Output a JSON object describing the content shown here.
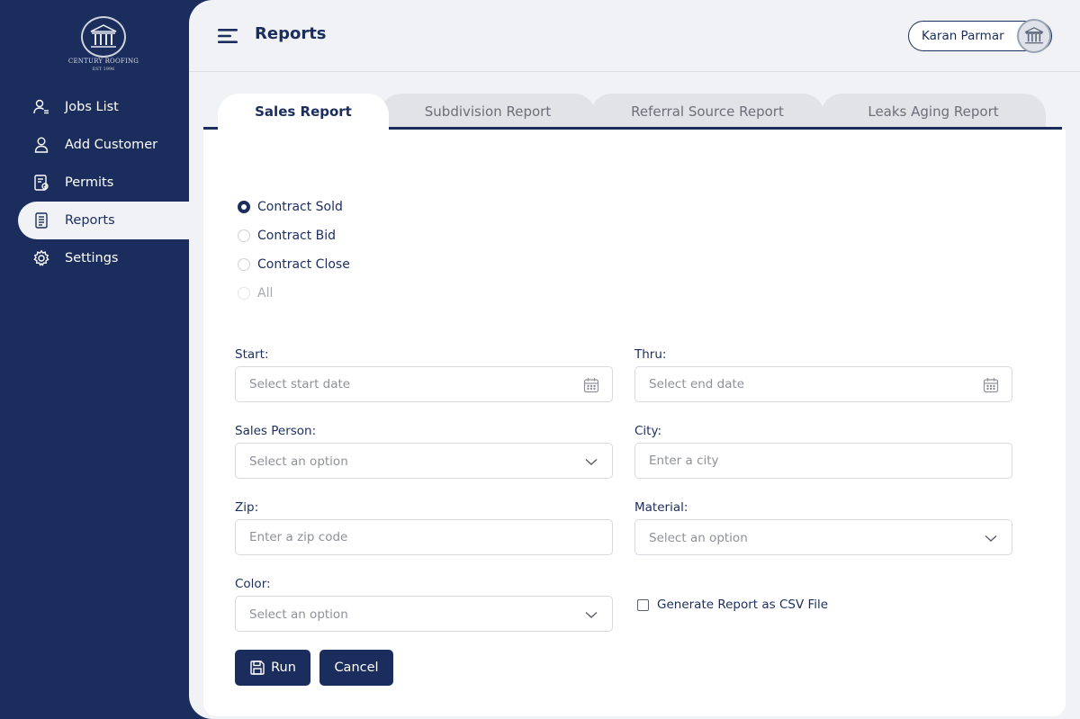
{
  "app": {
    "logo_text": "CENTURY ROOFING",
    "logo_sub": "EST 1996"
  },
  "sidebar": {
    "items": [
      {
        "label": "Jobs List",
        "icon": "user-list-icon"
      },
      {
        "label": "Add Customer",
        "icon": "user-icon"
      },
      {
        "label": "Permits",
        "icon": "permit-document-icon"
      },
      {
        "label": "Reports",
        "icon": "report-document-icon",
        "active": true
      },
      {
        "label": "Settings",
        "icon": "gear-icon"
      }
    ]
  },
  "header": {
    "title": "Reports",
    "user_name": "Karan Parmar"
  },
  "tabs": [
    {
      "label": "Sales Report",
      "active": true
    },
    {
      "label": "Subdivision Report"
    },
    {
      "label": "Referral Source Report"
    },
    {
      "label": "Leaks Aging Report"
    }
  ],
  "report_type": {
    "options": [
      {
        "label": "Contract Sold",
        "checked": true
      },
      {
        "label": "Contract Bid"
      },
      {
        "label": "Contract Close"
      },
      {
        "label": "All",
        "disabled": true
      }
    ]
  },
  "form": {
    "start": {
      "label": "Start:",
      "placeholder": "Select start date"
    },
    "thru": {
      "label": "Thru:",
      "placeholder": "Select end date"
    },
    "sales_person": {
      "label": "Sales Person:",
      "placeholder": "Select an option"
    },
    "city": {
      "label": "City:",
      "placeholder": "Enter a city"
    },
    "zip": {
      "label": "Zip:",
      "placeholder": "Enter a zip code"
    },
    "material": {
      "label": "Material:",
      "placeholder": "Select an option"
    },
    "color": {
      "label": "Color:",
      "placeholder": "Select an option"
    },
    "csv_label": "Generate Report as CSV File",
    "csv_checked": false
  },
  "buttons": {
    "run": "Run",
    "cancel": "Cancel"
  },
  "colors": {
    "brand_navy": "#1b2d5c",
    "background": "#f1f2f5",
    "card": "#ffffff"
  }
}
